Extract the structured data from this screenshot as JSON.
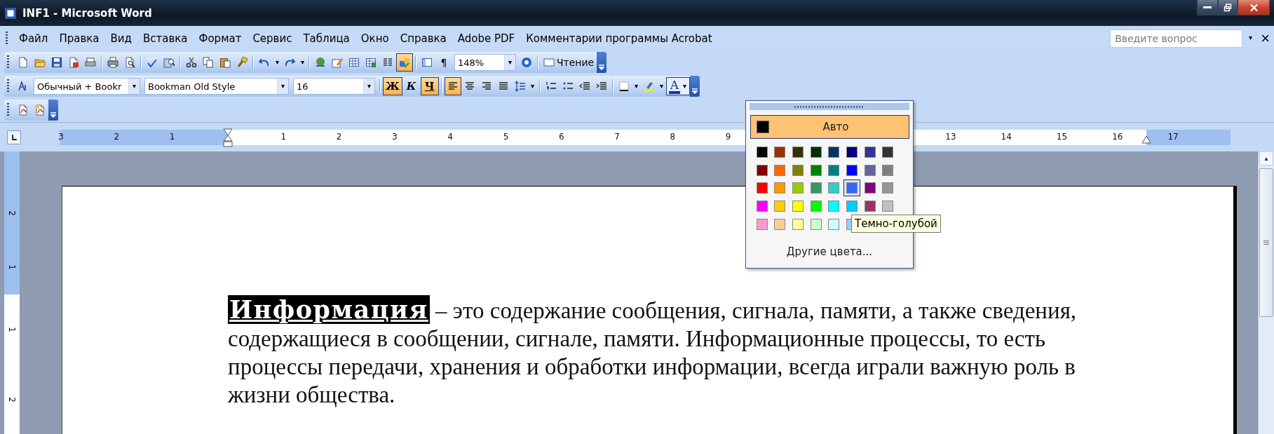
{
  "window": {
    "title": "INF1 - Microsoft Word"
  },
  "menu": [
    "Файл",
    "Правка",
    "Вид",
    "Вставка",
    "Формат",
    "Сервис",
    "Таблица",
    "Окно",
    "Справка",
    "Adobe PDF",
    "Комментарии программы Acrobat"
  ],
  "help_box": {
    "placeholder": "Введите вопрос"
  },
  "close_document": "×",
  "standard_toolbar": {
    "buttons": [
      {
        "pressed": false
      },
      {
        "pressed": false
      },
      {
        "pressed": false
      },
      {
        "pressed": false
      },
      {
        "pressed": false
      },
      {
        "pressed": false
      },
      {
        "pressed": false
      },
      {
        "pressed": false
      },
      {
        "pressed": false
      },
      {
        "pressed": false
      },
      {
        "pressed": false
      },
      {
        "pressed": false
      },
      {
        "pressed": false
      },
      {
        "pressed": false
      },
      {
        "pressed": false
      },
      {
        "pressed": false
      },
      {
        "pressed": false
      },
      {
        "pressed": false
      },
      {
        "pressed": false
      },
      {
        "pressed": false
      },
      {
        "pressed": true
      },
      {
        "pressed": false
      },
      {
        "pressed": false
      }
    ],
    "show_marks": "¶",
    "zoom": "148%",
    "reading": "Чтение"
  },
  "formatting_toolbar": {
    "style": "Обычный + Bookr",
    "font": "Bookman Old Style",
    "size": "16",
    "font_style_buttons": [
      {
        "label": "Ж",
        "pressed": true
      },
      {
        "label": "К",
        "pressed": false
      },
      {
        "label": "Ч",
        "pressed": true
      }
    ],
    "align_buttons": [
      {
        "pressed": true
      },
      {
        "pressed": false
      },
      {
        "pressed": false
      },
      {
        "pressed": false
      }
    ],
    "font_color": {
      "label": "A",
      "open": true
    }
  },
  "ruler": {
    "left_numbers": [
      "3",
      "2",
      "1"
    ],
    "numbers": [
      "1",
      "2",
      "3",
      "4",
      "5",
      "6",
      "7",
      "8",
      "9"
    ],
    "far_numbers": [
      "13",
      "14",
      "15",
      "16",
      "17"
    ]
  },
  "vertical_ruler": [
    "2",
    "1",
    "1",
    "2"
  ],
  "document": {
    "paragraph": "**Информация** – это содержание сообщения, сигнала, памяти, а также сведения, содержащиеся в сообщении, сигнале, памяти. Информационные процессы, то есть процессы передачи, хранения и обработки информации, всегда играли важную роль в жизни общества."
  },
  "color_menu": {
    "auto": {
      "label": "Авто",
      "color": "#000000",
      "highlighted": true
    },
    "swatches": [
      {
        "color": "#000000",
        "selected": false
      },
      {
        "color": "#993300",
        "selected": false
      },
      {
        "color": "#333300",
        "selected": false
      },
      {
        "color": "#003300",
        "selected": false
      },
      {
        "color": "#003366",
        "selected": false
      },
      {
        "color": "#000080",
        "selected": false
      },
      {
        "color": "#333399",
        "selected": false
      },
      {
        "color": "#333333",
        "selected": false
      },
      {
        "color": "#800000",
        "selected": false
      },
      {
        "color": "#ff6600",
        "selected": false
      },
      {
        "color": "#808000",
        "selected": false
      },
      {
        "color": "#008000",
        "selected": false
      },
      {
        "color": "#008080",
        "selected": false
      },
      {
        "color": "#0000ff",
        "selected": false
      },
      {
        "color": "#666699",
        "selected": false
      },
      {
        "color": "#808080",
        "selected": false
      },
      {
        "color": "#ff0000",
        "selected": false
      },
      {
        "color": "#ff9900",
        "selected": false
      },
      {
        "color": "#99cc00",
        "selected": false
      },
      {
        "color": "#339966",
        "selected": false
      },
      {
        "color": "#33cccc",
        "selected": false
      },
      {
        "color": "#3366ff",
        "selected": true
      },
      {
        "color": "#800080",
        "selected": false
      },
      {
        "color": "#969696",
        "selected": false
      },
      {
        "color": "#ff00ff",
        "selected": false
      },
      {
        "color": "#ffcc00",
        "selected": false
      },
      {
        "color": "#ffff00",
        "selected": false
      },
      {
        "color": "#00ff00",
        "selected": false
      },
      {
        "color": "#00ffff",
        "selected": false
      },
      {
        "color": "#00ccff",
        "selected": false
      },
      {
        "color": "#993366",
        "selected": false
      },
      {
        "color": "#c0c0c0",
        "selected": false
      },
      {
        "color": "#ff99cc",
        "selected": false
      },
      {
        "color": "#ffcc99",
        "selected": false
      },
      {
        "color": "#ffff99",
        "selected": false
      },
      {
        "color": "#ccffcc",
        "selected": false
      },
      {
        "color": "#ccffff",
        "selected": false
      },
      {
        "color": "#99ccff",
        "selected": false
      }
    ],
    "tooltip": "Темно-голубой",
    "more": "Другие цвета..."
  }
}
